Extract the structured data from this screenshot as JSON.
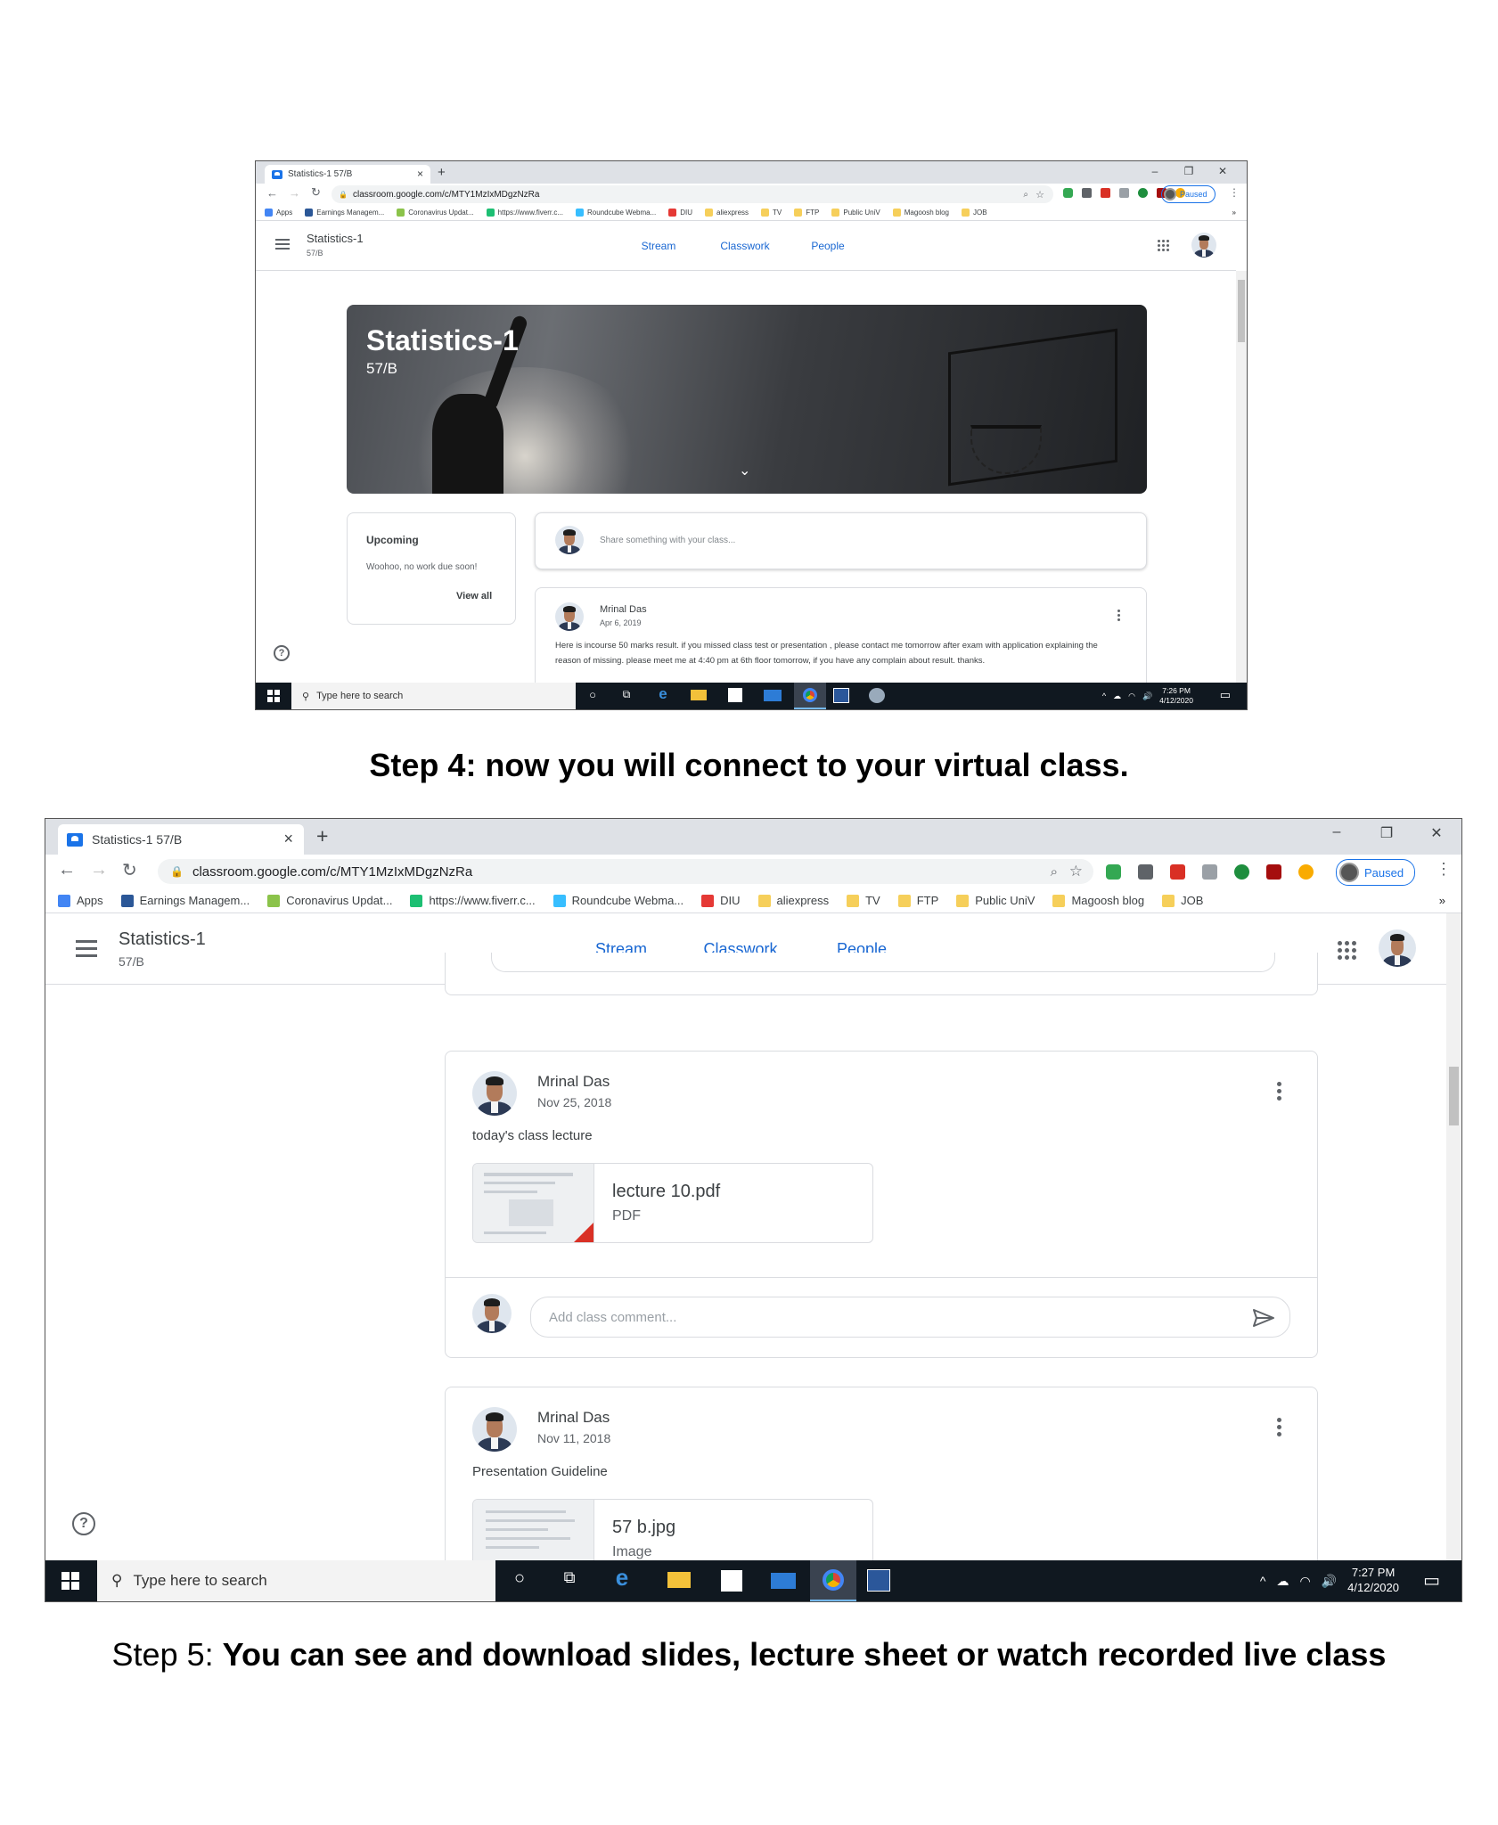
{
  "browser": {
    "tab_title": "Statistics-1 57/B",
    "tab_close": "×",
    "new_tab": "+",
    "minimize": "–",
    "restore": "❐",
    "close": "✕",
    "url": "classroom.google.com/c/MTY1MzIxMDgzNzRa",
    "profile_status": "Paused",
    "menu": "⋮",
    "bookmarks_more": "»",
    "bookmarks": [
      {
        "label": "Apps",
        "icon": "apps-grid-icon",
        "color": "#4285f4"
      },
      {
        "label": "Earnings Managem...",
        "icon": "earnings-icon",
        "color": "#2b5797"
      },
      {
        "label": "Coronavirus Updat...",
        "icon": "w-icon",
        "color": "#8bc34a"
      },
      {
        "label": "https://www.fiverr.c...",
        "icon": "fiverr-icon",
        "color": "#1dbf73"
      },
      {
        "label": "Roundcube Webma...",
        "icon": "roundcube-icon",
        "color": "#37beff"
      },
      {
        "label": "DIU",
        "icon": "diu-icon",
        "color": "#e53935"
      },
      {
        "label": "aliexpress",
        "icon": "folder-icon",
        "color": "#f6cf5a"
      },
      {
        "label": "TV",
        "icon": "folder-icon",
        "color": "#f6cf5a"
      },
      {
        "label": "FTP",
        "icon": "folder-icon",
        "color": "#f6cf5a"
      },
      {
        "label": "Public UniV",
        "icon": "folder-icon",
        "color": "#f6cf5a"
      },
      {
        "label": "Magoosh blog",
        "icon": "folder-icon",
        "color": "#f6cf5a"
      },
      {
        "label": "JOB",
        "icon": "folder-icon",
        "color": "#f6cf5a"
      }
    ]
  },
  "classroom": {
    "class_name": "Statistics-1",
    "section": "57/B",
    "tabs": [
      "Stream",
      "Classwork",
      "People"
    ],
    "active_tab": "Stream",
    "accent": "#1967d2"
  },
  "screen1": {
    "banner_title": "Statistics-1",
    "banner_section": "57/B",
    "upcoming_title": "Upcoming",
    "upcoming_text": "Woohoo, no work due soon!",
    "view_all": "View all",
    "share_placeholder": "Share something with your class...",
    "post": {
      "author": "Mrinal Das",
      "date": "Apr 6, 2019",
      "text": "Here is incourse 50 marks result. if you missed class test or presentation , please contact me tomorrow after exam with application explaining the reason of missing. please meet me at 4:40 pm at 6th floor tomorrow, if you have any complain about result. thanks."
    },
    "taskbar_time": "7:26 PM",
    "taskbar_date": "4/12/2020"
  },
  "step4": "Step 4: now you will connect to your virtual class.",
  "screen2": {
    "posts": [
      {
        "author": "Mrinal Das",
        "date": "Nov 25, 2018",
        "text": "today's class lecture",
        "attachment_name": "lecture 10.pdf",
        "attachment_type": "PDF",
        "comment_placeholder": "Add class comment..."
      },
      {
        "author": "Mrinal Das",
        "date": "Nov 11, 2018",
        "text": "Presentation Guideline",
        "attachment_name": "57 b.jpg",
        "attachment_type": "Image"
      }
    ],
    "taskbar_time": "7:27 PM",
    "taskbar_date": "4/12/2020"
  },
  "taskbar": {
    "search_placeholder": "Type here to search"
  },
  "step5_prefix": "Step 5: ",
  "step5_bold": "You can see and download slides, lecture sheet or watch recorded live class"
}
